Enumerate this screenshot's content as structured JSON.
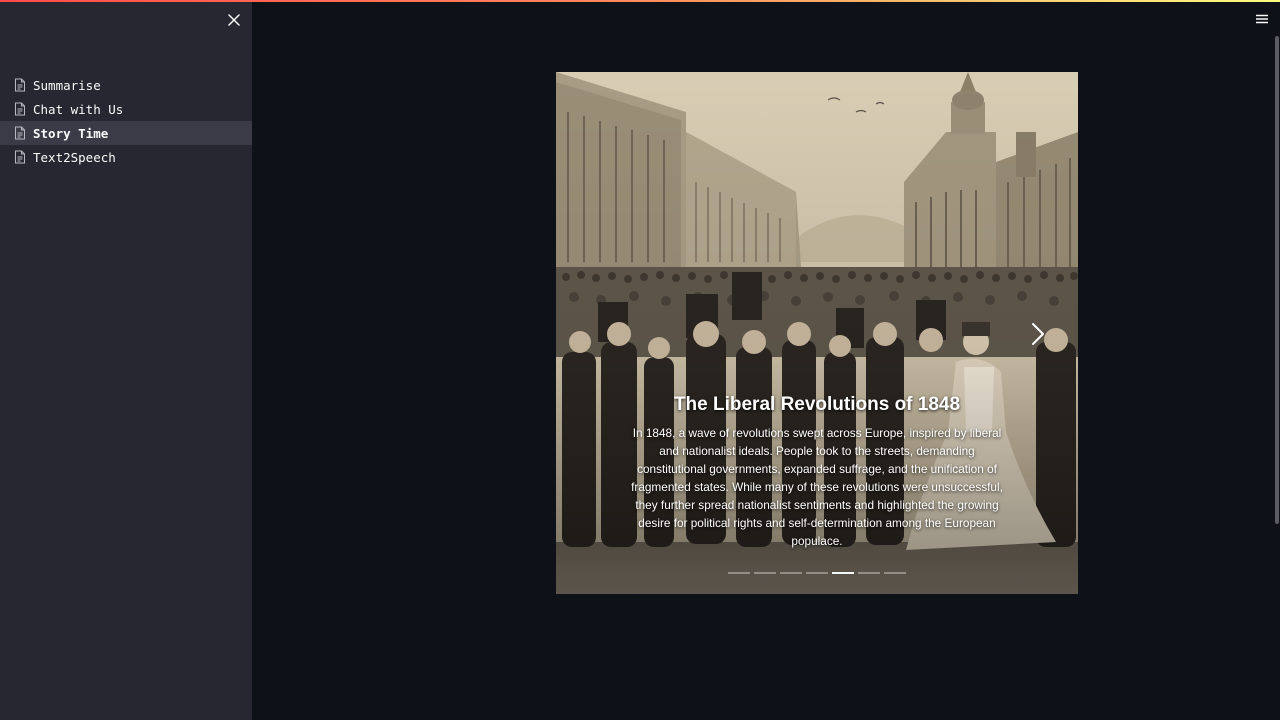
{
  "sidebar": {
    "close_icon": "close-icon",
    "items": [
      {
        "label": "Summarise",
        "icon": "document-icon",
        "active": false
      },
      {
        "label": "Chat with Us",
        "icon": "document-icon",
        "active": false
      },
      {
        "label": "Story Time",
        "icon": "document-icon",
        "active": true
      },
      {
        "label": "Text2Speech",
        "icon": "document-icon",
        "active": false
      }
    ]
  },
  "header": {
    "menu_icon": "hamburger-menu-icon"
  },
  "carousel": {
    "slide": {
      "title": "The Liberal Revolutions of 1848",
      "text": "In 1848, a wave of revolutions swept across Europe, inspired by liberal and nationalist ideals. People took to the streets, demanding constitutional governments, expanded suffrage, and the unification of fragmented states. While many of these revolutions were unsuccessful, they further spread nationalist sentiments and highlighted the growing desire for political rights and self-determination among the European populace.",
      "image": "sepia engraving of a crowd of 19th-century revolutionaries in a city square"
    },
    "indicator_count": 7,
    "active_indicator": 4,
    "next_icon": "chevron-right-icon"
  },
  "colors": {
    "background": "#0e1117",
    "sidebar": "#262730",
    "active_item": "#3a3b47",
    "text": "#fafafa",
    "accent_start": "#ff4b4b",
    "accent_end": "#fffd80"
  }
}
